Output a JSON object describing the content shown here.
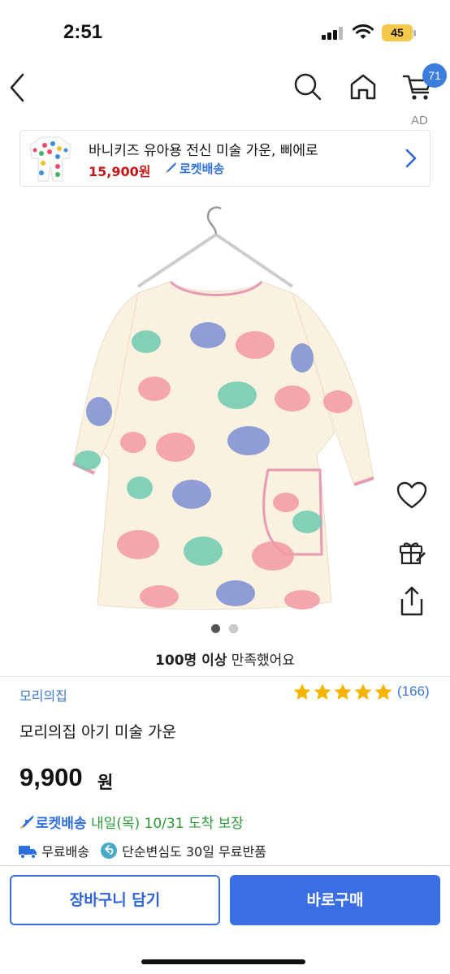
{
  "status_bar": {
    "time": "2:51",
    "battery": "45"
  },
  "nav": {
    "back_icon": "chevron-left-icon",
    "search_icon": "search-icon",
    "home_icon": "home-icon",
    "cart_icon": "cart-icon",
    "cart_badge": "71"
  },
  "ad": {
    "label": "AD",
    "title": "바니키즈 유아용 전신 미술 가운, 삐에로",
    "price": "15,900원",
    "rocket": "로켓배송"
  },
  "carousel": {
    "total": 2,
    "active": 1
  },
  "satisfaction": {
    "bold": "100명 이상",
    "text": " 만족했어요"
  },
  "brand": "모리의집",
  "rating": {
    "stars": 5,
    "max": 5,
    "count": "(166)"
  },
  "product_name": "모리의집 아기 미술 가운",
  "price": {
    "value": "9,900",
    "unit": "원"
  },
  "delivery": {
    "rocket_label": "로켓배송",
    "date": " 내일(목) 10/31 도착 보장"
  },
  "shipping": {
    "free": "무료배송",
    "returns": "단순변심도 30일 무료반품"
  },
  "buttons": {
    "add_to_cart": "장바구니 담기",
    "buy_now": "바로구매"
  },
  "colors": {
    "accent": "#3a6fe3",
    "price_red": "#c71616",
    "rocket_blue": "#2d6fe0",
    "delivery_green": "#2a9a34",
    "star": "#f6b400",
    "badge": "#3c7ee0"
  }
}
